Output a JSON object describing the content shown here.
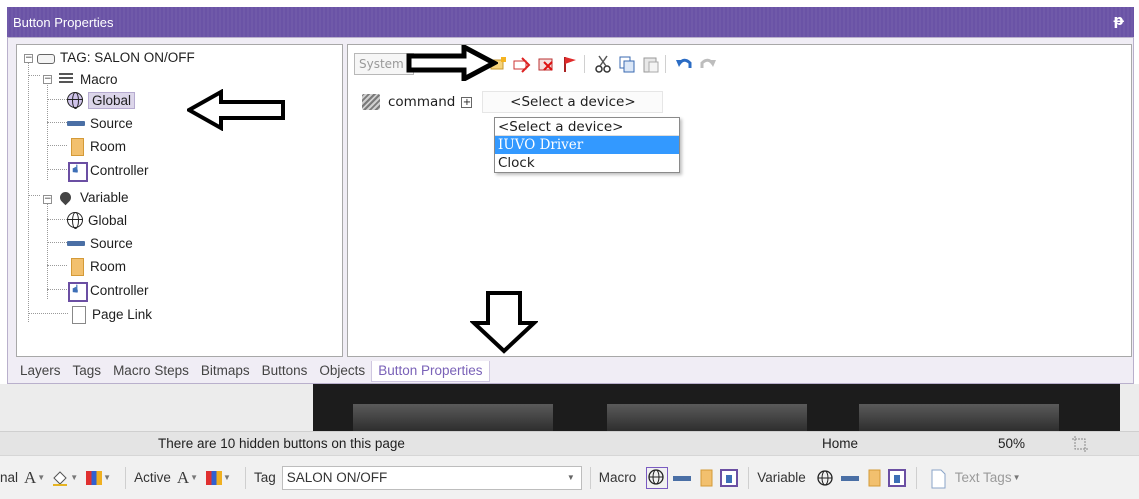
{
  "panel": {
    "title": "Button Properties",
    "pin_icon": "pin-icon"
  },
  "tree": {
    "root_label": "TAG: SALON ON/OFF",
    "macro_label": "Macro",
    "macro_children": [
      "Global",
      "Source",
      "Room",
      "Controller"
    ],
    "variable_label": "Variable",
    "variable_children": [
      "Global",
      "Source",
      "Room",
      "Controller"
    ],
    "page_link_label": "Page Link",
    "selected": "Global"
  },
  "editor": {
    "system_combo": "System",
    "command_label": "command",
    "device_select": "<Select a device>",
    "dropdown_options": [
      "<Select a device>",
      "IUVO Driver",
      "Clock"
    ],
    "dropdown_selected": "IUVO Driver"
  },
  "tabs": [
    "Layers",
    "Tags",
    "Macro Steps",
    "Bitmaps",
    "Buttons",
    "Objects",
    "Button Properties"
  ],
  "active_tab": "Button Properties",
  "status": {
    "hidden_buttons": "There are 10 hidden buttons on this page",
    "page": "Home",
    "zoom": "50%"
  },
  "bottombar": {
    "normal_label": "nal",
    "active_label": "Active",
    "font_glyph": "A",
    "tag_label": "Tag",
    "tag_value": "SALON ON/OFF",
    "macro_label": "Macro",
    "variable_label": "Variable",
    "text_tags_label": "Text Tags"
  },
  "colors": {
    "titlebar": "#6a53a6",
    "selection": "#3399ff",
    "active_tab_text": "#7a62b8"
  }
}
